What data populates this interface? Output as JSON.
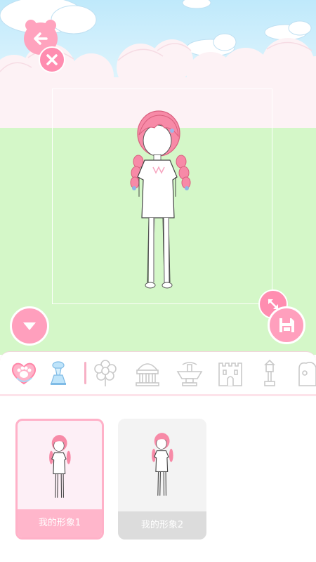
{
  "scene": {
    "sky_color": "#cdeefc",
    "grass_color": "#d4f7c8",
    "cloud_color": "#fdf2f5",
    "accent_color": "#ff9fbd"
  },
  "buttons": {
    "back": "back-arrow-icon",
    "close": "close-x-icon",
    "collapse": "chevron-down-icon",
    "resize": "resize-arrows-icon",
    "save": "floppy-disk-icon"
  },
  "toolbar": {
    "items": [
      {
        "name": "heart-paw-icon",
        "selected": true
      },
      {
        "name": "fountain-lamp-icon",
        "selected": false
      },
      {
        "name": "flower-icon",
        "selected": false
      },
      {
        "name": "pavilion-icon",
        "selected": false
      },
      {
        "name": "fountain-icon",
        "selected": false
      },
      {
        "name": "castle-icon",
        "selected": false
      },
      {
        "name": "street-lamp-icon",
        "selected": false
      },
      {
        "name": "more-decoration-icon",
        "selected": false
      }
    ]
  },
  "avatars": [
    {
      "label": "我的形象1",
      "selected": true
    },
    {
      "label": "我的形象2",
      "selected": false
    }
  ]
}
